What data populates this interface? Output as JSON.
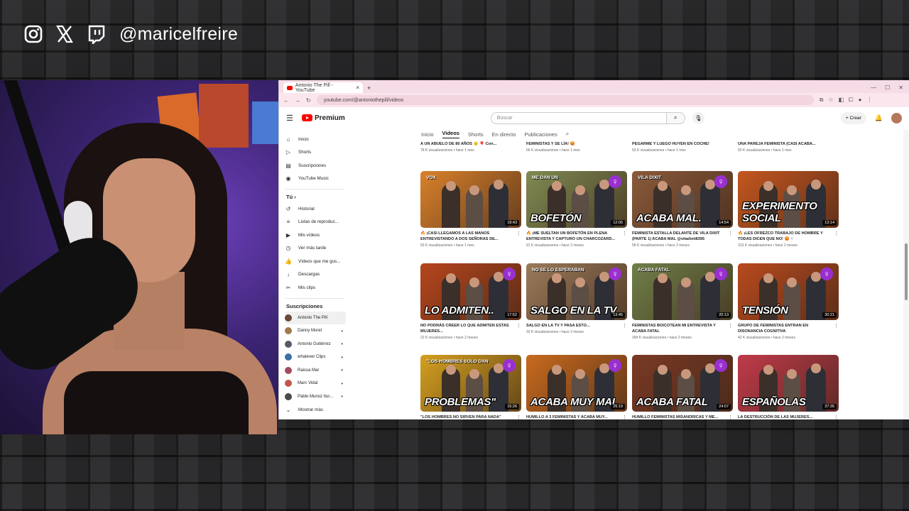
{
  "overlay": {
    "handle": "@maricelfreire",
    "icons": [
      "instagram-icon",
      "x-icon",
      "twitch-icon"
    ]
  },
  "browser": {
    "tab_title": "Antonio The Pill - YouTube",
    "url": "youtube.com/@antoniothepill/videos"
  },
  "youtube": {
    "logo_text": "Premium",
    "search_placeholder": "Buscar",
    "create_label": "Crear",
    "sidebar": {
      "main": [
        {
          "label": "Inicio",
          "icon": "home-icon",
          "glyph": "⌂"
        },
        {
          "label": "Shorts",
          "icon": "shorts-icon",
          "glyph": "▷"
        },
        {
          "label": "Suscripciones",
          "icon": "subscriptions-icon",
          "glyph": "▤"
        },
        {
          "label": "YouTube Music",
          "icon": "music-icon",
          "glyph": "◉"
        }
      ],
      "you_section": "Tú",
      "you": [
        {
          "label": "Historial",
          "icon": "history-icon",
          "glyph": "↺"
        },
        {
          "label": "Listas de reproduc...",
          "icon": "playlist-icon",
          "glyph": "≡"
        },
        {
          "label": "Mis vídeos",
          "icon": "my-videos-icon",
          "glyph": "▶"
        },
        {
          "label": "Ver más tarde",
          "icon": "watch-later-icon",
          "glyph": "◷"
        },
        {
          "label": "Vídeos que me gus...",
          "icon": "thumbs-up-icon",
          "glyph": "👍"
        },
        {
          "label": "Descargas",
          "icon": "download-icon",
          "glyph": "↓"
        },
        {
          "label": "Mis clips",
          "icon": "clips-icon",
          "glyph": "✂"
        }
      ],
      "subs_section": "Suscripciones",
      "subs": [
        {
          "label": "Antonio The Pill",
          "color": "#6b4a3a",
          "active": true
        },
        {
          "label": "Danny Morel",
          "color": "#a07a4a",
          "active": false
        },
        {
          "label": "Antonio Gutiérrez",
          "color": "#555b66",
          "active": false
        },
        {
          "label": "whatever Clips",
          "color": "#3a6fa8",
          "active": false
        },
        {
          "label": "Raissa Mar",
          "color": "#a34a5e",
          "active": false
        },
        {
          "label": "Marc Vidal",
          "color": "#c4574a",
          "active": false
        },
        {
          "label": "Pablo Munoz Itur...",
          "color": "#4a4a4a",
          "active": false
        }
      ],
      "show_more": "Mostrar más"
    },
    "channel_tabs": [
      {
        "label": "Inicio",
        "active": false
      },
      {
        "label": "Videos",
        "active": true
      },
      {
        "label": "Shorts",
        "active": false
      },
      {
        "label": "En directo",
        "active": false
      },
      {
        "label": "Publicaciones",
        "active": false
      }
    ],
    "partial_row": [
      {
        "title": "A UN ABUELO DE 80 AÑOS 👴 🎈 Con...",
        "stats": "78 K visualizaciones • hace 1 mes"
      },
      {
        "title": "FEMINISTAS Y SE LÍA! 😡",
        "stats": "66 K visualizaciones • hace 1 mes"
      },
      {
        "title": "PEGARME Y LUEGO HUYEN EN COCHE!",
        "stats": "53 K visualizaciones • hace 1 mes"
      },
      {
        "title": "UNA PAREJA FEMINISTA (CASI ACABA...",
        "stats": "50 K visualizaciones • hace 1 mes"
      }
    ],
    "videos": [
      {
        "thumb_text": "",
        "badge": "VOX",
        "duration": "18:43",
        "bg": "#d9812b",
        "feminist": false,
        "title": "🔥 ¡CASI LLEGAMOS A LAS MANOS ENTREVISTANDO A DOS SEÑORAS DE...",
        "stats": "93 K visualizaciones • hace 1 mes"
      },
      {
        "thumb_text": "BOFETÓN",
        "badge": "ME DAN UN",
        "duration": "12:05",
        "bg": "#7f8a52",
        "feminist": true,
        "title": "🔥 ¡ME SUELTAN UN BOFETÓN EN PLENA ENTREVISTA Y CAPTURO UN CHARCOZARD...",
        "stats": "91 K visualizaciones • hace 2 meses"
      },
      {
        "thumb_text": "ACABA MAL.",
        "badge": "VILA DIXIT",
        "duration": "14:54",
        "bg": "#8a5a3a",
        "feminist": true,
        "title": "FEMINISTA ESTALLA DELANTE DE VILA DIXIT (PARTE 1) ACABA MAL @viladixit8395",
        "stats": "58 K visualizaciones • hace 2 meses"
      },
      {
        "thumb_text": "EXPERIMENTO SOCIAL",
        "badge": "",
        "duration": "13:14",
        "bg": "#c4561f",
        "feminist": false,
        "title": "🔥 ¡LES OFREZCO TRABAJO DE HOMBRE Y TODAS DICEN QUE NO! 😡 ♀",
        "stats": "313 K visualizaciones • hace 2 meses"
      },
      {
        "thumb_text": "LO ADMITEN..",
        "badge": "",
        "duration": "17:52",
        "bg": "#b5451c",
        "feminist": true,
        "title": "NO PODRÁS CREER LO QUE ADMITEN ESTAS MUJERES...",
        "stats": "22 K visualizaciones • hace 2 meses"
      },
      {
        "thumb_text": "SALGO EN LA TV",
        "badge": "NO SE LO ESPERABAN",
        "duration": "13:45",
        "bg": "#9a7a5a",
        "feminist": true,
        "title": "SALGO EN LA TV Y PASA ESTO...",
        "stats": "32 K visualizaciones • hace 2 meses"
      },
      {
        "thumb_text": "",
        "badge": "ACABA FATAL",
        "duration": "20:13",
        "bg": "#6f7f48",
        "feminist": true,
        "title": "FEMINISTAS BOICOTEAN MI ENTREVISTA Y ACABA FATAL",
        "stats": "184 K visualizaciones • hace 2 meses"
      },
      {
        "thumb_text": "TENSIÓN",
        "badge": "",
        "duration": "30:21",
        "bg": "#b84a1e",
        "feminist": true,
        "title": "GRUPO DE FEMINISTAS ENTRAN EN DISONANCIA COGNITIVA",
        "stats": "42 K visualizaciones • hace 2 meses"
      },
      {
        "thumb_text": "PROBLEMAS\"",
        "badge": "\"LOS HOMBRES SOLO DAN",
        "duration": "15:26",
        "bg": "#d4a01f",
        "feminist": true,
        "title": "\"LOS HOMBRES NO SIRVEN PARA NADA\"",
        "stats": ""
      },
      {
        "thumb_text": "ACABA MUY MAL",
        "badge": "",
        "duration": "26:19",
        "bg": "#c86a1e",
        "feminist": true,
        "title": "HUMILLO A 3 FEMINISTAS Y ACABA MUY...",
        "stats": ""
      },
      {
        "thumb_text": "ACABA FATAL",
        "badge": "",
        "duration": "24:07",
        "bg": "#7a3a24",
        "feminist": true,
        "title": "HUMILLO FEMINISTAS MISANDRICAS Y ME...",
        "stats": ""
      },
      {
        "thumb_text": "ESPAÑOLAS",
        "badge": "",
        "duration": "37:35",
        "bg": "#c03a4a",
        "feminist": false,
        "title": "LA DESTRUCCIÓN DE LAS MUJERES...",
        "stats": ""
      }
    ]
  }
}
